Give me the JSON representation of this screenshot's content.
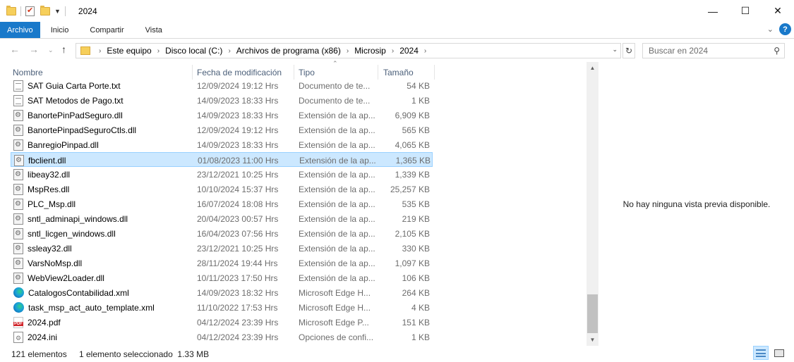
{
  "window": {
    "title": "2024",
    "minimize": "—",
    "maximize": "☐",
    "close": "✕"
  },
  "ribbon": {
    "tabs": [
      "Archivo",
      "Inicio",
      "Compartir",
      "Vista"
    ],
    "help": "?"
  },
  "address": {
    "breadcrumbs": [
      "Este equipo",
      "Disco local (C:)",
      "Archivos de programa (x86)",
      "Microsip",
      "2024"
    ],
    "search_placeholder": "Buscar en 2024"
  },
  "columns": {
    "name": "Nombre",
    "date": "Fecha de modificación",
    "type": "Tipo",
    "size": "Tamaño"
  },
  "files": [
    {
      "name": "SAT Guia Carta Porte.txt",
      "date": "12/09/2024 19:12 Hrs",
      "type": "Documento de te...",
      "size": "54 KB",
      "icon": "text-file-icon"
    },
    {
      "name": "SAT Metodos de Pago.txt",
      "date": "14/09/2023 18:33 Hrs",
      "type": "Documento de te...",
      "size": "1 KB",
      "icon": "text-file-icon"
    },
    {
      "name": "BanortePinPadSeguro.dll",
      "date": "14/09/2023 18:33 Hrs",
      "type": "Extensión de la ap...",
      "size": "6,909 KB",
      "icon": "dll-file-icon"
    },
    {
      "name": "BanortePinpadSeguroCtls.dll",
      "date": "12/09/2024 19:12 Hrs",
      "type": "Extensión de la ap...",
      "size": "565 KB",
      "icon": "dll-file-icon"
    },
    {
      "name": "BanregioPinpad.dll",
      "date": "14/09/2023 18:33 Hrs",
      "type": "Extensión de la ap...",
      "size": "4,065 KB",
      "icon": "dll-file-icon"
    },
    {
      "name": "fbclient.dll",
      "date": "01/08/2023 11:00 Hrs",
      "type": "Extensión de la ap...",
      "size": "1,365 KB",
      "icon": "dll-file-icon",
      "selected": true
    },
    {
      "name": "libeay32.dll",
      "date": "23/12/2021 10:25 Hrs",
      "type": "Extensión de la ap...",
      "size": "1,339 KB",
      "icon": "dll-file-icon"
    },
    {
      "name": "MspRes.dll",
      "date": "10/10/2024 15:37 Hrs",
      "type": "Extensión de la ap...",
      "size": "25,257 KB",
      "icon": "dll-file-icon"
    },
    {
      "name": "PLC_Msp.dll",
      "date": "16/07/2024 18:08 Hrs",
      "type": "Extensión de la ap...",
      "size": "535 KB",
      "icon": "dll-file-icon"
    },
    {
      "name": "sntl_adminapi_windows.dll",
      "date": "20/04/2023 00:57 Hrs",
      "type": "Extensión de la ap...",
      "size": "219 KB",
      "icon": "dll-file-icon"
    },
    {
      "name": "sntl_licgen_windows.dll",
      "date": "16/04/2023 07:56 Hrs",
      "type": "Extensión de la ap...",
      "size": "2,105 KB",
      "icon": "dll-file-icon"
    },
    {
      "name": "ssleay32.dll",
      "date": "23/12/2021 10:25 Hrs",
      "type": "Extensión de la ap...",
      "size": "330 KB",
      "icon": "dll-file-icon"
    },
    {
      "name": "VarsNoMsp.dll",
      "date": "28/11/2024 19:44 Hrs",
      "type": "Extensión de la ap...",
      "size": "1,097 KB",
      "icon": "dll-file-icon"
    },
    {
      "name": "WebView2Loader.dll",
      "date": "10/11/2023 17:50 Hrs",
      "type": "Extensión de la ap...",
      "size": "106 KB",
      "icon": "dll-file-icon"
    },
    {
      "name": "CatalogosContabilidad.xml",
      "date": "14/09/2023 18:32 Hrs",
      "type": "Microsoft Edge H...",
      "size": "264 KB",
      "icon": "edge-xml-icon"
    },
    {
      "name": "task_msp_act_auto_template.xml",
      "date": "11/10/2022 17:53 Hrs",
      "type": "Microsoft Edge H...",
      "size": "4 KB",
      "icon": "edge-xml-icon"
    },
    {
      "name": "2024.pdf",
      "date": "04/12/2024 23:39 Hrs",
      "type": "Microsoft Edge P...",
      "size": "151 KB",
      "icon": "pdf-file-icon"
    },
    {
      "name": "2024.ini",
      "date": "04/12/2024 23:39 Hrs",
      "type": "Opciones de confi...",
      "size": "1 KB",
      "icon": "ini-file-icon"
    }
  ],
  "preview": {
    "message": "No hay ninguna vista previa disponible."
  },
  "status": {
    "count": "121 elementos",
    "selection": "1 elemento seleccionado  1.33 MB"
  },
  "colors": {
    "accent": "#1979ca",
    "selection_bg": "#cce8ff",
    "selection_border": "#99d1ff"
  }
}
